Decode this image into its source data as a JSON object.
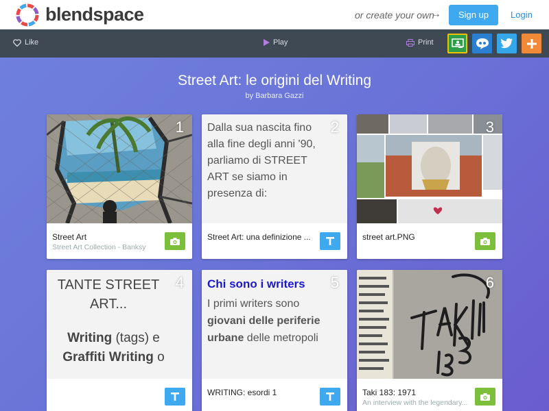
{
  "header": {
    "logo_text": "blendspace",
    "create_own": "or create your own",
    "signup": "Sign up",
    "login": "Login"
  },
  "toolbar": {
    "like": "Like",
    "play": "Play",
    "print": "Print",
    "share_icons": [
      "google-classroom-icon",
      "remind-icon",
      "twitter-icon",
      "add-icon"
    ]
  },
  "lesson": {
    "title": "Street Art: le origini del Writing",
    "author": "by Barbara Gazzi"
  },
  "cards": [
    {
      "number": "1",
      "caption": "Street Art",
      "subcaption": "Street Art Collection - Banksy",
      "type": "photo"
    },
    {
      "number": "2",
      "caption": "Street Art: una definizione ...",
      "subcaption": "",
      "type": "text",
      "body": "Dalla sua nascita fino alla fine degli anni '90, parliamo di STREET ART se siamo in presenza di:"
    },
    {
      "number": "3",
      "caption": "street art.PNG",
      "subcaption": "",
      "type": "photo"
    },
    {
      "number": "4",
      "caption": "",
      "subcaption": "",
      "type": "text",
      "body_line1": "TANTE STREET",
      "body_line2": "ART...",
      "body_bold1": "Writing",
      "body_rest1": " (tags) e",
      "body_bold2": "Graffiti Writing",
      "body_rest2": " o"
    },
    {
      "number": "5",
      "caption": "WRITING: esordi 1",
      "subcaption": "",
      "type": "text",
      "heading": "Chi sono i writers",
      "body_pre": "I primi writers sono ",
      "body_bold": "giovani delle periferie urbane",
      "body_post": " delle metropoli"
    },
    {
      "number": "6",
      "caption": "Taki 183: 1971",
      "subcaption": "An interview with the legendary...",
      "type": "photo"
    }
  ],
  "colors": {
    "accent_blue": "#3fa9f0",
    "photo_green": "#7cbf3a",
    "toolbar": "#3f4954",
    "background_gradient": [
      "#6f7fdd",
      "#6a5ccf"
    ]
  }
}
